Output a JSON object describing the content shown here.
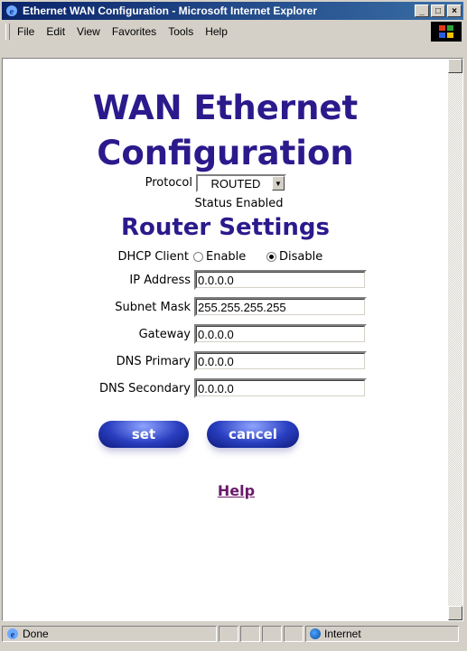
{
  "window": {
    "title": "Ethernet WAN Configuration - Microsoft Internet Explorer",
    "minimize": "_",
    "restore": "□",
    "close": "×"
  },
  "menu": {
    "file": "File",
    "edit": "Edit",
    "view": "View",
    "favorites": "Favorites",
    "tools": "Tools",
    "help": "Help"
  },
  "page": {
    "title_line1": "WAN Ethernet",
    "title_line2": "Configuration",
    "protocol_label": "Protocol",
    "protocol_value": "ROUTED",
    "status_text": "Status Enabled",
    "router_heading": "Router Settings",
    "dhcp_label": "DHCP Client",
    "dhcp_enable": "Enable",
    "dhcp_disable": "Disable",
    "dhcp_selected": "Disable",
    "ip_label": "IP Address",
    "ip_value": "0.0.0.0",
    "subnet_label": "Subnet Mask",
    "subnet_value": "255.255.255.255",
    "gateway_label": "Gateway",
    "gateway_value": "0.0.0.0",
    "dns1_label": "DNS Primary",
    "dns1_value": "0.0.0.0",
    "dns2_label": "DNS Secondary",
    "dns2_value": "0.0.0.0",
    "set_label": "set",
    "cancel_label": "cancel",
    "help_link": "Help"
  },
  "status": {
    "done": "Done",
    "zone": "Internet"
  },
  "colors": {
    "heading": "#2b1a8c",
    "titlebar_start": "#0a246a",
    "titlebar_end": "#3a6ea5",
    "link": "#6b1a6b"
  }
}
